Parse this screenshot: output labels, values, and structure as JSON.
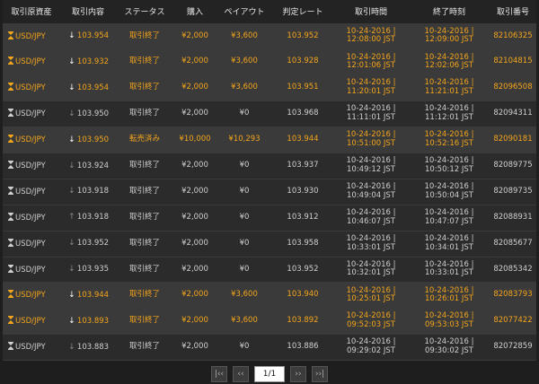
{
  "headers": [
    "取引原資産",
    "取引内容",
    "ステータス",
    "購入",
    "ペイアウト",
    "判定レート",
    "取引時間",
    "終了時刻",
    "取引番号"
  ],
  "rows": [
    {
      "hl": true,
      "asset": "USD/JPY",
      "dir": "down",
      "rate": "103.954",
      "status": "取引終了",
      "buy": "¥2,000",
      "payout": "¥3,600",
      "judge": "103.952",
      "t1": "10-24-2016 |",
      "t2": "12:08:00 JST",
      "e1": "10-24-2016 |",
      "e2": "12:09:00 JST",
      "id": "82106325"
    },
    {
      "hl": true,
      "asset": "USD/JPY",
      "dir": "down",
      "rate": "103.932",
      "status": "取引終了",
      "buy": "¥2,000",
      "payout": "¥3,600",
      "judge": "103.928",
      "t1": "10-24-2016 |",
      "t2": "12:01:06 JST",
      "e1": "10-24-2016 |",
      "e2": "12:02:06 JST",
      "id": "82104815"
    },
    {
      "hl": true,
      "asset": "USD/JPY",
      "dir": "down",
      "rate": "103.954",
      "status": "取引終了",
      "buy": "¥2,000",
      "payout": "¥3,600",
      "judge": "103.951",
      "t1": "10-24-2016 |",
      "t2": "11:20:01 JST",
      "e1": "10-24-2016 |",
      "e2": "11:21:01 JST",
      "id": "82096508"
    },
    {
      "hl": false,
      "asset": "USD/JPY",
      "dir": "down",
      "rate": "103.950",
      "status": "取引終了",
      "buy": "¥2,000",
      "payout": "¥0",
      "judge": "103.968",
      "t1": "10-24-2016 |",
      "t2": "11:11:01 JST",
      "e1": "10-24-2016 |",
      "e2": "11:12:01 JST",
      "id": "82094311"
    },
    {
      "hl": true,
      "asset": "USD/JPY",
      "dir": "down",
      "rate": "103.950",
      "status": "転売済み",
      "buy": "¥10,000",
      "payout": "¥10,293",
      "judge": "103.944",
      "t1": "10-24-2016 |",
      "t2": "10:51:00 JST",
      "e1": "10-24-2016 |",
      "e2": "10:52:16 JST",
      "id": "82090181"
    },
    {
      "hl": false,
      "asset": "USD/JPY",
      "dir": "down",
      "rate": "103.924",
      "status": "取引終了",
      "buy": "¥2,000",
      "payout": "¥0",
      "judge": "103.937",
      "t1": "10-24-2016 |",
      "t2": "10:49:12 JST",
      "e1": "10-24-2016 |",
      "e2": "10:50:12 JST",
      "id": "82089775"
    },
    {
      "hl": false,
      "asset": "USD/JPY",
      "dir": "down",
      "rate": "103.918",
      "status": "取引終了",
      "buy": "¥2,000",
      "payout": "¥0",
      "judge": "103.930",
      "t1": "10-24-2016 |",
      "t2": "10:49:04 JST",
      "e1": "10-24-2016 |",
      "e2": "10:50:04 JST",
      "id": "82089735"
    },
    {
      "hl": false,
      "asset": "USD/JPY",
      "dir": "up",
      "rate": "103.918",
      "status": "取引終了",
      "buy": "¥2,000",
      "payout": "¥0",
      "judge": "103.912",
      "t1": "10-24-2016 |",
      "t2": "10:46:07 JST",
      "e1": "10-24-2016 |",
      "e2": "10:47:07 JST",
      "id": "82088931"
    },
    {
      "hl": false,
      "asset": "USD/JPY",
      "dir": "down",
      "rate": "103.952",
      "status": "取引終了",
      "buy": "¥2,000",
      "payout": "¥0",
      "judge": "103.958",
      "t1": "10-24-2016 |",
      "t2": "10:33:01 JST",
      "e1": "10-24-2016 |",
      "e2": "10:34:01 JST",
      "id": "82085677"
    },
    {
      "hl": false,
      "asset": "USD/JPY",
      "dir": "down",
      "rate": "103.935",
      "status": "取引終了",
      "buy": "¥2,000",
      "payout": "¥0",
      "judge": "103.952",
      "t1": "10-24-2016 |",
      "t2": "10:32:01 JST",
      "e1": "10-24-2016 |",
      "e2": "10:33:01 JST",
      "id": "82085342"
    },
    {
      "hl": true,
      "asset": "USD/JPY",
      "dir": "down",
      "rate": "103.944",
      "status": "取引終了",
      "buy": "¥2,000",
      "payout": "¥3,600",
      "judge": "103.940",
      "t1": "10-24-2016 |",
      "t2": "10:25:01 JST",
      "e1": "10-24-2016 |",
      "e2": "10:26:01 JST",
      "id": "82083793"
    },
    {
      "hl": true,
      "asset": "USD/JPY",
      "dir": "down",
      "rate": "103.893",
      "status": "取引終了",
      "buy": "¥2,000",
      "payout": "¥3,600",
      "judge": "103.892",
      "t1": "10-24-2016 |",
      "t2": "09:52:03 JST",
      "e1": "10-24-2016 |",
      "e2": "09:53:03 JST",
      "id": "82077422"
    },
    {
      "hl": false,
      "asset": "USD/JPY",
      "dir": "down",
      "rate": "103.883",
      "status": "取引終了",
      "buy": "¥2,000",
      "payout": "¥0",
      "judge": "103.886",
      "t1": "10-24-2016 |",
      "t2": "09:29:02 JST",
      "e1": "10-24-2016 |",
      "e2": "09:30:02 JST",
      "id": "82072859"
    }
  ],
  "pager": {
    "first": "|‹‹",
    "prev": "‹‹",
    "page": "1/1",
    "next": "››",
    "last": "››|"
  },
  "icons": {
    "asset": "hourglass-icon",
    "down": "arrow-down-icon",
    "up": "arrow-up-icon"
  },
  "colors": {
    "highlight_text": "#f3a51c",
    "highlight_bg": "#3a3a3a",
    "normal_bg": "#2b2b2b",
    "page_bg": "#1e1e1e"
  }
}
